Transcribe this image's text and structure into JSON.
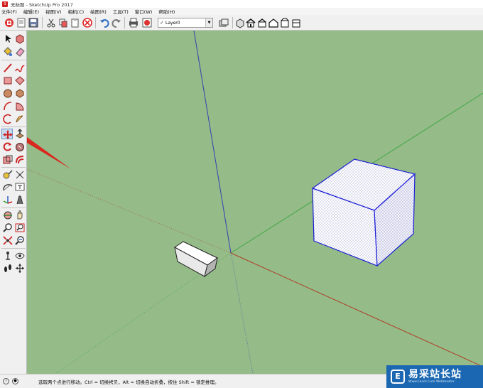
{
  "window": {
    "title": "无标题 - SketchUp Pro 2017",
    "app_icon_glyph": "S"
  },
  "menu": [
    "文件(F)",
    "编辑(E)",
    "视图(V)",
    "相机(C)",
    "绘图(R)",
    "工具(T)",
    "窗口(W)",
    "帮助(H)"
  ],
  "toolbar": {
    "layer": {
      "check": "✓",
      "name": "Layer0",
      "arrow": "▼"
    }
  },
  "colors": {
    "viewport_bg": "#94bb88",
    "axis_red": "#b0402a",
    "axis_green": "#46a848",
    "axis_blue": "#3a3fae",
    "selection_blue": "#1b1fd6",
    "watermark_bg": "#1b67b2"
  },
  "icons": {
    "toolbar": [
      "new-file-icon",
      "open-file-icon",
      "save-icon",
      "cut-icon",
      "copy-icon",
      "paste-icon",
      "erase-icon",
      "undo-icon",
      "redo-icon",
      "print-icon",
      "model-info-icon",
      "layer-manager-icon",
      "iso-view-icon",
      "top-view-icon",
      "front-view-icon",
      "right-view-icon",
      "back-view-icon",
      "left-view-icon"
    ],
    "tools": [
      "select-icon",
      "make-component-icon",
      "paint-bucket-icon",
      "eraser-icon",
      "line-icon",
      "freehand-icon",
      "rectangle-icon",
      "rotated-rectangle-icon",
      "circle-icon",
      "polygon-icon",
      "arc-icon",
      "pie-icon",
      "two-point-arc-icon",
      "three-point-arc-icon",
      "move-icon",
      "push-pull-icon",
      "rotate-icon",
      "follow-me-icon",
      "scale-icon",
      "offset-icon",
      "tape-measure-icon",
      "dimension-icon",
      "protractor-icon",
      "text-icon",
      "axes-icon",
      "3d-text-icon",
      "orbit-icon",
      "pan-icon",
      "zoom-icon",
      "zoom-window-icon",
      "zoom-extents-icon",
      "previous-view-icon",
      "position-camera-icon",
      "look-around-icon",
      "walk-icon",
      "section-plane-icon"
    ]
  },
  "status": {
    "text": "选取两个点进行移动。Ctrl = 切换拷贝，Alt = 切换自动折叠，按住 Shift = 锁定推理。"
  },
  "watermark": {
    "title": "易采站长站",
    "url": "Www.Easck.Com Webmaster",
    "logo_glyph": "E"
  }
}
